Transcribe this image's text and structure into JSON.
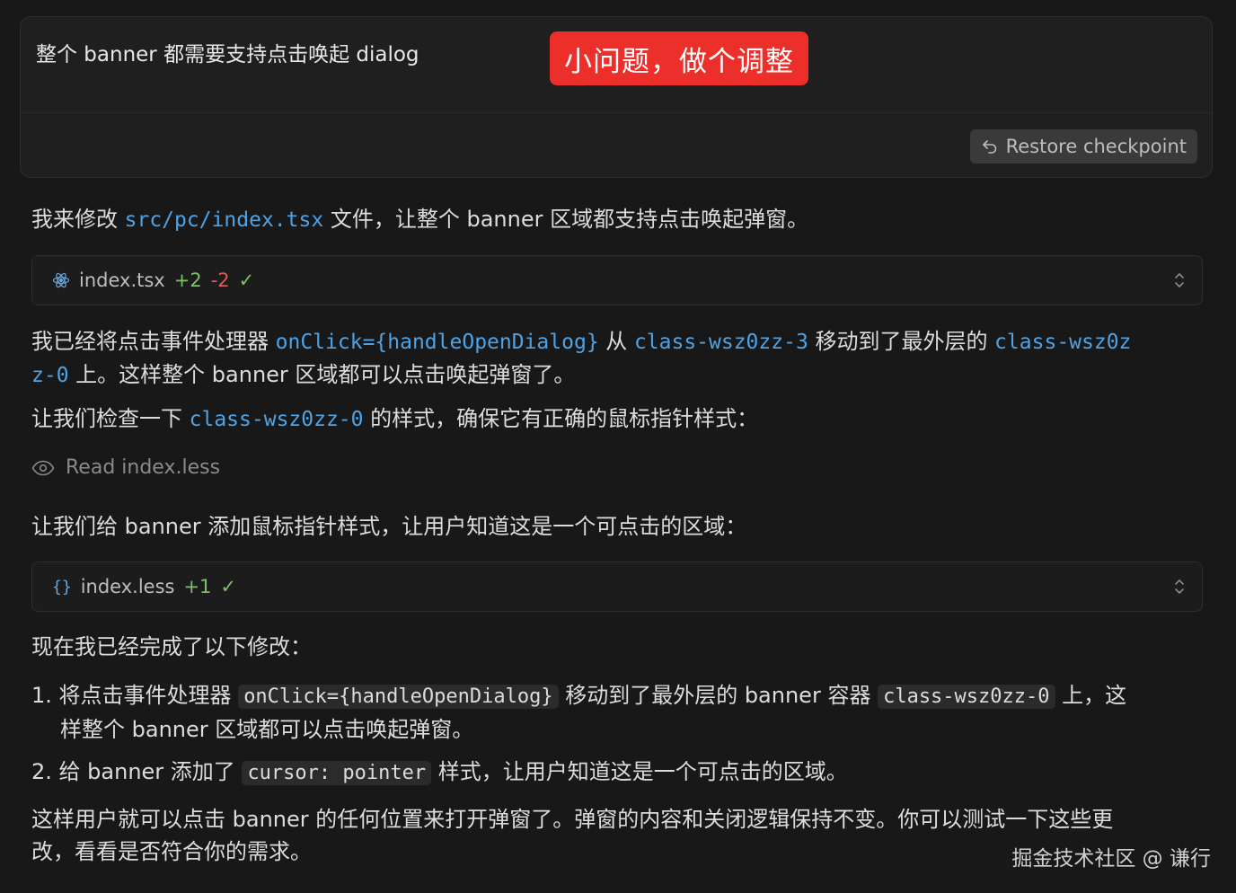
{
  "prompt": {
    "text": "整个 banner 都需要支持点击唤起 dialog",
    "annotation": "小问题，做个调整",
    "restore_label": "Restore checkpoint"
  },
  "message1": {
    "pre": "我来修改 ",
    "code": "src/pc/index.tsx",
    "post": " 文件，让整个 banner 区域都支持点击唤起弹窗。"
  },
  "file1": {
    "name": "index.tsx",
    "added": "+2",
    "removed": "-2",
    "status": "✓",
    "icon": "react-icon"
  },
  "message2": {
    "p1": "我已经将点击事件处理器 ",
    "c1": "onClick={handleOpenDialog}",
    "p2": " 从 ",
    "c2": "class-wsz0zz-3",
    "p3": " 移动到了最外层的 ",
    "c3a": "class-wsz0z",
    "c3b": "z-0",
    "p4": " 上。这样整个 banner 区域都可以点击唤起弹窗了。"
  },
  "message3": {
    "pre": "让我们检查一下 ",
    "code": "class-wsz0zz-0",
    "post": " 的样式，确保它有正确的鼠标指针样式："
  },
  "read_step": {
    "label": "Read index.less",
    "icon": "eye-icon"
  },
  "message4": "让我们给 banner 添加鼠标指针样式，让用户知道这是一个可点击的区域：",
  "file2": {
    "name": "index.less",
    "added": "+1",
    "status": "✓",
    "icon": "braces-icon"
  },
  "summary": {
    "heading": "现在我已经完成了以下修改：",
    "item1": {
      "num": "1.",
      "a": "将点击事件处理器 ",
      "code1": "onClick={handleOpenDialog}",
      "b": " 移动到了最外层的 banner 容器 ",
      "code2": "class-wsz0zz-0",
      "c": " 上，这",
      "d": "样整个 banner 区域都可以点击唤起弹窗。"
    },
    "item2": {
      "num": "2.",
      "a": "给 banner 添加了 ",
      "code": "cursor: pointer",
      "b": " 样式，让用户知道这是一个可点击的区域。"
    },
    "closing1": "这样用户就可以点击 banner 的任何位置来打开弹窗了。弹窗的内容和关闭逻辑保持不变。你可以测试一下这些更",
    "closing2": "改，看看是否符合你的需求。"
  },
  "watermark": "掘金技术社区 @ 谦行",
  "colors": {
    "background": "#181818",
    "code_blue": "#4ea3e6",
    "annotation_red": "#ec2f2a",
    "added_green": "#7fbf6a",
    "removed_red": "#e05a5a"
  }
}
